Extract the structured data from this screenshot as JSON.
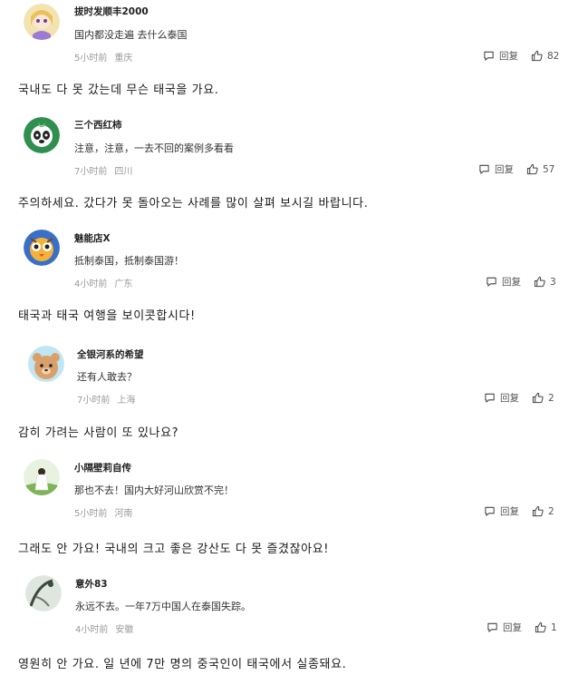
{
  "labels": {
    "reply": "回复"
  },
  "comments": [
    {
      "username": "拔时发顺丰2000",
      "text": "国内都没走遍 去什么泰国",
      "time": "5小时前",
      "location": "重庆",
      "likes": "82",
      "translation": "국내도 다 못 갔는데 무슨 태국을 가요."
    },
    {
      "username": "三个西红柿",
      "text": "注意，注意，一去不回的案例多看看",
      "time": "7小时前",
      "location": "四川",
      "likes": "57",
      "translation": "주의하세요. 갔다가 못 돌아오는 사례를 많이 살펴 보시길 바랍니다."
    },
    {
      "username": "魅能店X",
      "text": "抵制泰国，抵制泰国游！",
      "time": "4小时前",
      "location": "广东",
      "likes": "3",
      "translation": "태국과 태국 여행을 보이콧합시다!"
    },
    {
      "username": "全银河系的希望",
      "text": "还有人敢去？",
      "time": "7小时前",
      "location": "上海",
      "likes": "2",
      "translation": "감히 가려는 사람이 또 있나요?"
    },
    {
      "username": "小隔壁莉自传",
      "text": "那也不去！国内大好河山欣赏不完！",
      "time": "5小时前",
      "location": "河南",
      "likes": "2",
      "translation": "그래도 안 가요! 국내의 크고 좋은 강산도 다 못 즐겼잖아요!"
    },
    {
      "username": "意外83",
      "text": "永远不去。一年7万中国人在泰国失踪。",
      "time": "4小时前",
      "location": "安徽",
      "likes": "1",
      "translation": "영원히 안 가요. 일 년에 7만 명의 중국인이 태국에서 실종돼요."
    }
  ]
}
